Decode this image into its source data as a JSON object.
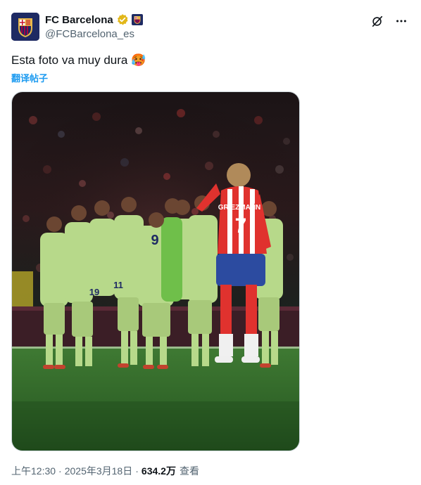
{
  "account": {
    "display_name": "FC Barcelona",
    "handle": "@FCBarcelona_es",
    "verified_badge": "gold-verified-check-icon",
    "affiliate_badge": "fc-barcelona-crest-icon",
    "avatar_icon": "fc-barcelona-crest-icon"
  },
  "header_actions": {
    "grok_icon": "grok-icon",
    "more_icon": "more-options-icon"
  },
  "tweet": {
    "text": "Esta foto va muy dura",
    "emoji": "🥵",
    "translate_label": "翻译帖子"
  },
  "media": {
    "type": "photo",
    "player_numbers": [
      "9",
      "11",
      "7",
      "19"
    ],
    "jersey_name": "GRIEZMANN"
  },
  "meta": {
    "time": "上午12:30",
    "date": "2025年3月18日",
    "views_count": "634.2万",
    "views_label": "查看",
    "separator": "·"
  },
  "colors": {
    "link_blue": "#1d9bf0",
    "text_primary": "#0f1419",
    "text_secondary": "#536471",
    "verified_gold": "#e2b719",
    "barca_blue": "#1e2a63",
    "barca_red": "#a50044",
    "kit_lime": "#b7d98a"
  }
}
